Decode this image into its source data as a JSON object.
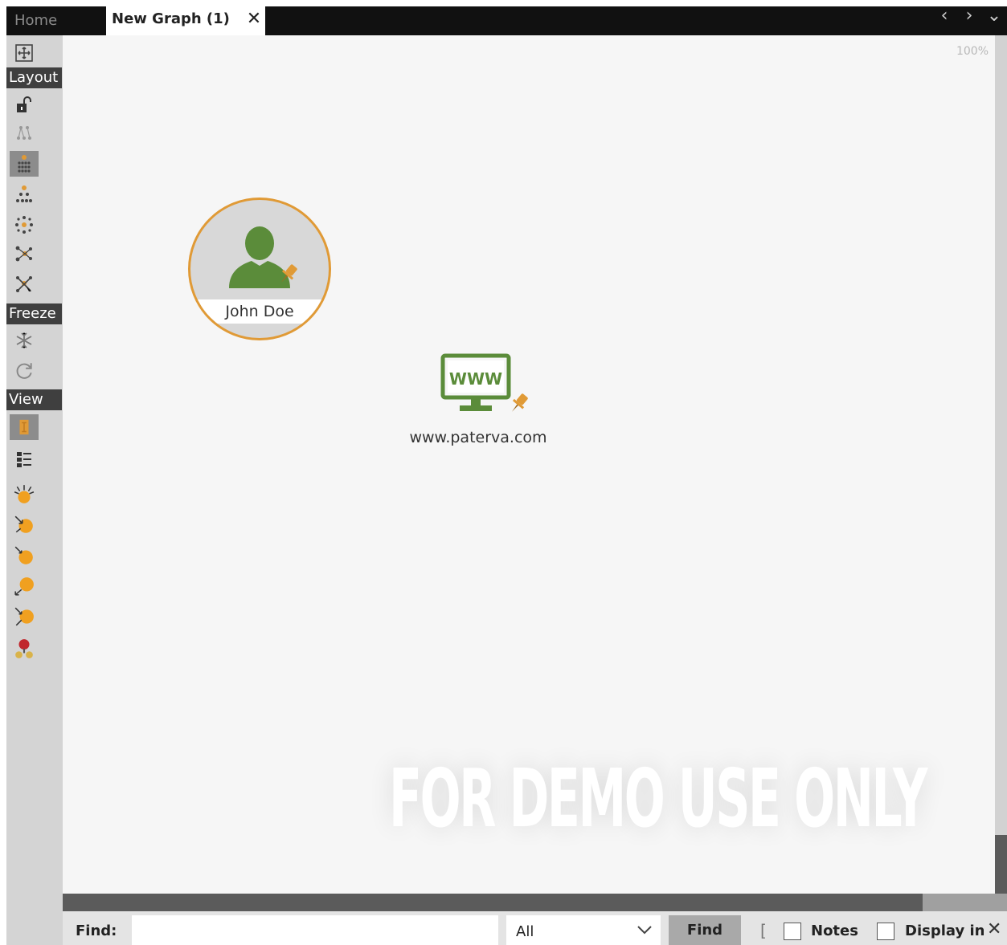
{
  "tabs": {
    "home_label": "Home",
    "active_label": "New Graph (1)",
    "close_glyph": "✕"
  },
  "nav": {
    "prev": "‹",
    "next": "›",
    "menu": "⌄"
  },
  "toolbar": {
    "sections": {
      "layout": "Layout",
      "freeze": "Freeze",
      "view": "View"
    },
    "icons": [
      "fit-to-screen-icon",
      "unlock-icon",
      "layout-block-icon",
      "layout-hierarchical-icon",
      "layout-circular-icon",
      "layout-organic-icon",
      "layout-interactive-icon",
      "freeze-icon",
      "refresh-icon",
      "view-main-icon",
      "view-list-icon",
      "node-size-rank-icon",
      "node-incoming-icon",
      "node-outgoing-icon",
      "node-links-icon",
      "node-both-icon",
      "entity-color-icon"
    ]
  },
  "canvas": {
    "zoom_label": "100%",
    "watermark": "FOR DEMO USE ONLY",
    "entities": [
      {
        "type": "person",
        "label": "John Doe"
      },
      {
        "type": "website",
        "label": "www.paterva.com",
        "icon_text": "WWW"
      }
    ]
  },
  "findbar": {
    "label": "Find:",
    "input_value": "",
    "filter_value": "All",
    "button_label": "Find",
    "notes_label": "Notes",
    "display_label": "Display in",
    "close_glyph": "✕"
  },
  "colors": {
    "accent_orange": "#e09a36",
    "entity_green": "#5b8c3a",
    "toolbar_bg": "#d4d4d4",
    "section_bg": "#3f3f3f"
  }
}
